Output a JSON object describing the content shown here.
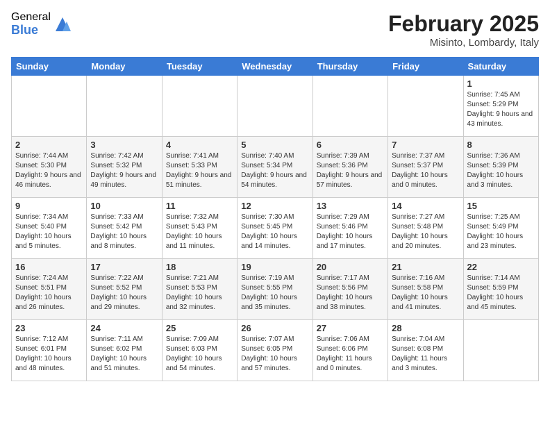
{
  "header": {
    "logo_general": "General",
    "logo_blue": "Blue",
    "month_title": "February 2025",
    "location": "Misinto, Lombardy, Italy"
  },
  "days_of_week": [
    "Sunday",
    "Monday",
    "Tuesday",
    "Wednesday",
    "Thursday",
    "Friday",
    "Saturday"
  ],
  "weeks": [
    [
      {
        "day": "",
        "info": ""
      },
      {
        "day": "",
        "info": ""
      },
      {
        "day": "",
        "info": ""
      },
      {
        "day": "",
        "info": ""
      },
      {
        "day": "",
        "info": ""
      },
      {
        "day": "",
        "info": ""
      },
      {
        "day": "1",
        "info": "Sunrise: 7:45 AM\nSunset: 5:29 PM\nDaylight: 9 hours and 43 minutes."
      }
    ],
    [
      {
        "day": "2",
        "info": "Sunrise: 7:44 AM\nSunset: 5:30 PM\nDaylight: 9 hours and 46 minutes."
      },
      {
        "day": "3",
        "info": "Sunrise: 7:42 AM\nSunset: 5:32 PM\nDaylight: 9 hours and 49 minutes."
      },
      {
        "day": "4",
        "info": "Sunrise: 7:41 AM\nSunset: 5:33 PM\nDaylight: 9 hours and 51 minutes."
      },
      {
        "day": "5",
        "info": "Sunrise: 7:40 AM\nSunset: 5:34 PM\nDaylight: 9 hours and 54 minutes."
      },
      {
        "day": "6",
        "info": "Sunrise: 7:39 AM\nSunset: 5:36 PM\nDaylight: 9 hours and 57 minutes."
      },
      {
        "day": "7",
        "info": "Sunrise: 7:37 AM\nSunset: 5:37 PM\nDaylight: 10 hours and 0 minutes."
      },
      {
        "day": "8",
        "info": "Sunrise: 7:36 AM\nSunset: 5:39 PM\nDaylight: 10 hours and 3 minutes."
      }
    ],
    [
      {
        "day": "9",
        "info": "Sunrise: 7:34 AM\nSunset: 5:40 PM\nDaylight: 10 hours and 5 minutes."
      },
      {
        "day": "10",
        "info": "Sunrise: 7:33 AM\nSunset: 5:42 PM\nDaylight: 10 hours and 8 minutes."
      },
      {
        "day": "11",
        "info": "Sunrise: 7:32 AM\nSunset: 5:43 PM\nDaylight: 10 hours and 11 minutes."
      },
      {
        "day": "12",
        "info": "Sunrise: 7:30 AM\nSunset: 5:45 PM\nDaylight: 10 hours and 14 minutes."
      },
      {
        "day": "13",
        "info": "Sunrise: 7:29 AM\nSunset: 5:46 PM\nDaylight: 10 hours and 17 minutes."
      },
      {
        "day": "14",
        "info": "Sunrise: 7:27 AM\nSunset: 5:48 PM\nDaylight: 10 hours and 20 minutes."
      },
      {
        "day": "15",
        "info": "Sunrise: 7:25 AM\nSunset: 5:49 PM\nDaylight: 10 hours and 23 minutes."
      }
    ],
    [
      {
        "day": "16",
        "info": "Sunrise: 7:24 AM\nSunset: 5:51 PM\nDaylight: 10 hours and 26 minutes."
      },
      {
        "day": "17",
        "info": "Sunrise: 7:22 AM\nSunset: 5:52 PM\nDaylight: 10 hours and 29 minutes."
      },
      {
        "day": "18",
        "info": "Sunrise: 7:21 AM\nSunset: 5:53 PM\nDaylight: 10 hours and 32 minutes."
      },
      {
        "day": "19",
        "info": "Sunrise: 7:19 AM\nSunset: 5:55 PM\nDaylight: 10 hours and 35 minutes."
      },
      {
        "day": "20",
        "info": "Sunrise: 7:17 AM\nSunset: 5:56 PM\nDaylight: 10 hours and 38 minutes."
      },
      {
        "day": "21",
        "info": "Sunrise: 7:16 AM\nSunset: 5:58 PM\nDaylight: 10 hours and 41 minutes."
      },
      {
        "day": "22",
        "info": "Sunrise: 7:14 AM\nSunset: 5:59 PM\nDaylight: 10 hours and 45 minutes."
      }
    ],
    [
      {
        "day": "23",
        "info": "Sunrise: 7:12 AM\nSunset: 6:01 PM\nDaylight: 10 hours and 48 minutes."
      },
      {
        "day": "24",
        "info": "Sunrise: 7:11 AM\nSunset: 6:02 PM\nDaylight: 10 hours and 51 minutes."
      },
      {
        "day": "25",
        "info": "Sunrise: 7:09 AM\nSunset: 6:03 PM\nDaylight: 10 hours and 54 minutes."
      },
      {
        "day": "26",
        "info": "Sunrise: 7:07 AM\nSunset: 6:05 PM\nDaylight: 10 hours and 57 minutes."
      },
      {
        "day": "27",
        "info": "Sunrise: 7:06 AM\nSunset: 6:06 PM\nDaylight: 11 hours and 0 minutes."
      },
      {
        "day": "28",
        "info": "Sunrise: 7:04 AM\nSunset: 6:08 PM\nDaylight: 11 hours and 3 minutes."
      },
      {
        "day": "",
        "info": ""
      }
    ]
  ]
}
